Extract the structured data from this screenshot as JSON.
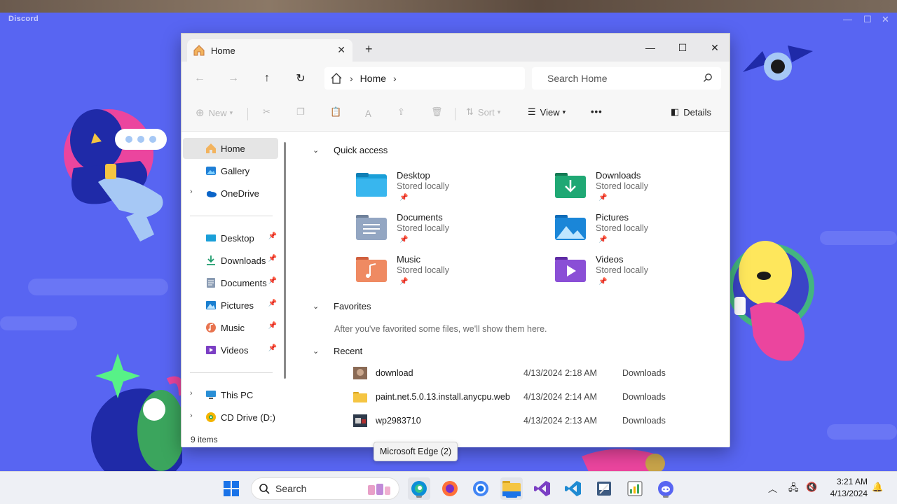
{
  "discord": {
    "app_name": "Discord",
    "window_controls": [
      "—",
      "☐",
      "✕"
    ]
  },
  "explorer": {
    "tab": {
      "label": "Home",
      "close": "✕"
    },
    "new_tab": "+",
    "window_controls": {
      "minimize": "—",
      "maximize": "☐",
      "close": "✕"
    },
    "breadcrumb": {
      "current": "Home",
      "sep": "›"
    },
    "search": {
      "placeholder": "Search Home"
    },
    "commands": {
      "new": "New",
      "sort": "Sort",
      "view": "View",
      "more": "•••",
      "details": "Details"
    },
    "nav": {
      "top": [
        {
          "label": "Home",
          "icon": "home-icon",
          "selected": true
        },
        {
          "label": "Gallery",
          "icon": "gallery-icon"
        },
        {
          "label": "OneDrive",
          "icon": "onedrive-icon",
          "expandable": true
        }
      ],
      "pinned": [
        {
          "label": "Desktop",
          "icon": "desktop-folder-icon"
        },
        {
          "label": "Downloads",
          "icon": "downloads-folder-icon"
        },
        {
          "label": "Documents",
          "icon": "documents-folder-icon"
        },
        {
          "label": "Pictures",
          "icon": "pictures-folder-icon"
        },
        {
          "label": "Music",
          "icon": "music-folder-icon"
        },
        {
          "label": "Videos",
          "icon": "videos-folder-icon"
        }
      ],
      "drives": [
        {
          "label": "This PC",
          "icon": "this-pc-icon"
        },
        {
          "label": "CD Drive (D:) Ins",
          "icon": "cd-drive-icon"
        }
      ]
    },
    "sections": {
      "quick_access": "Quick access",
      "favorites": "Favorites",
      "favorites_empty": "After you've favorited some files, we'll show them here.",
      "recent": "Recent"
    },
    "quick_access": [
      {
        "name": "Desktop",
        "sub": "Stored locally"
      },
      {
        "name": "Downloads",
        "sub": "Stored locally"
      },
      {
        "name": "Documents",
        "sub": "Stored locally"
      },
      {
        "name": "Pictures",
        "sub": "Stored locally"
      },
      {
        "name": "Music",
        "sub": "Stored locally"
      },
      {
        "name": "Videos",
        "sub": "Stored locally"
      }
    ],
    "recent": [
      {
        "name": "download",
        "date": "4/13/2024 2:18 AM",
        "location": "Downloads"
      },
      {
        "name": "paint.net.5.0.13.install.anycpu.web",
        "date": "4/13/2024 2:14 AM",
        "location": "Downloads"
      },
      {
        "name": "wp2983710",
        "date": "4/13/2024 2:13 AM",
        "location": "Downloads"
      }
    ],
    "status": {
      "count": "9 items"
    }
  },
  "tooltip": "Microsoft Edge (2)",
  "taskbar": {
    "search_label": "Search",
    "clock_time": "3:21 AM",
    "clock_date": "4/13/2024"
  },
  "colors": {
    "discord_blurple": "#5865f2",
    "explorer_accent": "#0067c0",
    "folder_yellow": "#f5c542"
  }
}
